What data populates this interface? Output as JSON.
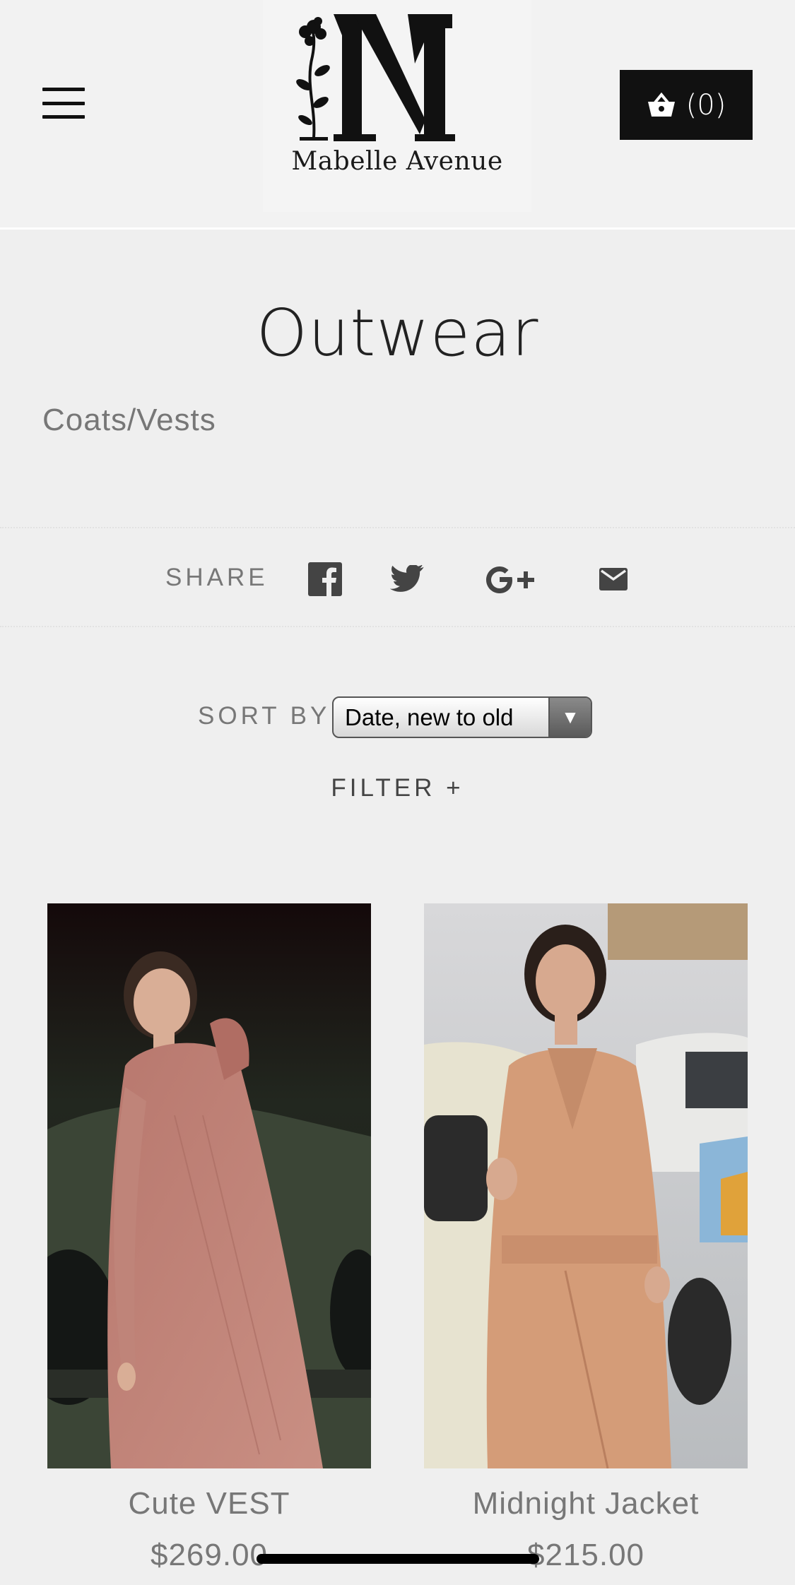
{
  "header": {
    "menu_icon": "hamburger-menu-icon",
    "logo_text": "Mabelle Avenue",
    "cart_icon": "shopping-basket-icon",
    "cart_count": "(0)"
  },
  "collection": {
    "title": "Outwear",
    "subtitle": "Coats/Vests"
  },
  "share": {
    "label": "SHARE",
    "icons": [
      "facebook-icon",
      "twitter-icon",
      "google-plus-icon",
      "email-icon"
    ]
  },
  "sort": {
    "label": "SORT BY",
    "selected": "Date, new to old"
  },
  "filter": {
    "label": "FILTER +"
  },
  "products": [
    {
      "name": "Cute VEST",
      "price": "$269.00"
    },
    {
      "name": "Midnight Jacket",
      "price": "$215.00"
    }
  ],
  "colors": {
    "cart_bg": "#111111",
    "page_bg": "#efefef",
    "muted_text": "#777777"
  }
}
